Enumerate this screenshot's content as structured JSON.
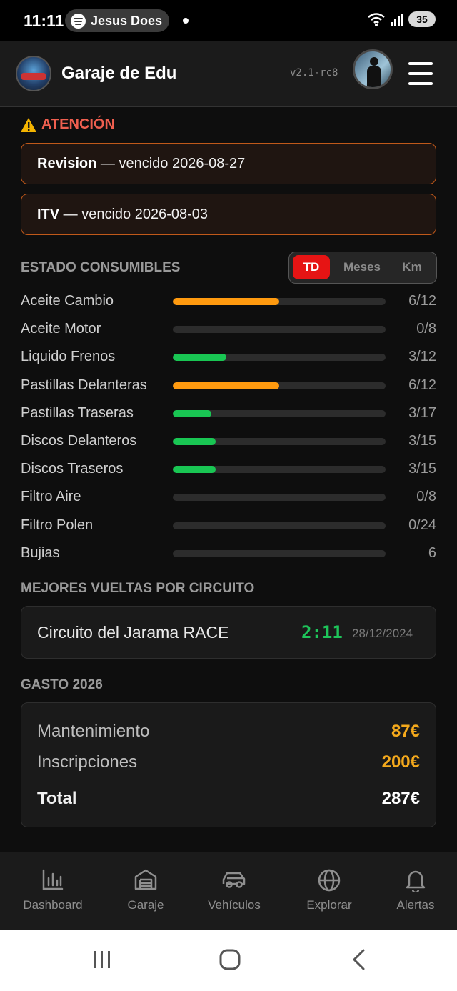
{
  "status_bar": {
    "time": "11:11",
    "media_pill": "Jesus Does",
    "battery": "35"
  },
  "header": {
    "title": "Garaje de Edu",
    "version": "v2.1-rc8"
  },
  "alerts": {
    "title": "ATENCIÓN",
    "items": [
      {
        "name": "Revision",
        "text": " — vencido 2026-08-27"
      },
      {
        "name": "ITV",
        "text": " — vencido 2026-08-03"
      }
    ]
  },
  "consumables": {
    "title": "ESTADO CONSUMIBLES",
    "tabs": [
      "TD",
      "Meses",
      "Km"
    ],
    "active_tab": "TD",
    "colors": {
      "warn": "#ff9a0f",
      "ok": "#19c653"
    },
    "items": [
      {
        "name": "Aceite Cambio",
        "value": "6/12",
        "fraction": 0.5,
        "status": "warn"
      },
      {
        "name": "Aceite Motor",
        "value": "0/8",
        "fraction": 0,
        "status": "ok"
      },
      {
        "name": "Liquido Frenos",
        "value": "3/12",
        "fraction": 0.25,
        "status": "ok"
      },
      {
        "name": "Pastillas Delanteras",
        "value": "6/12",
        "fraction": 0.5,
        "status": "warn"
      },
      {
        "name": "Pastillas Traseras",
        "value": "3/17",
        "fraction": 0.18,
        "status": "ok"
      },
      {
        "name": "Discos Delanteros",
        "value": "3/15",
        "fraction": 0.2,
        "status": "ok"
      },
      {
        "name": "Discos Traseros",
        "value": "3/15",
        "fraction": 0.2,
        "status": "ok"
      },
      {
        "name": "Filtro Aire",
        "value": "0/8",
        "fraction": 0,
        "status": "ok"
      },
      {
        "name": "Filtro Polen",
        "value": "0/24",
        "fraction": 0,
        "status": "ok"
      },
      {
        "name": "Bujias",
        "value": "6",
        "fraction": 0,
        "status": "ok"
      }
    ]
  },
  "laps": {
    "title": "MEJORES VUELTAS POR CIRCUITO",
    "items": [
      {
        "circuit": "Circuito del Jarama RACE",
        "time": "2:11",
        "date": "28/12/2024"
      }
    ]
  },
  "spending": {
    "title": "GASTO 2026",
    "rows": [
      {
        "label": "Mantenimiento",
        "value": "87€"
      },
      {
        "label": "Inscripciones",
        "value": "200€"
      }
    ],
    "total_label": "Total",
    "total_value": "287€"
  },
  "bottom_nav": [
    {
      "label": "Dashboard",
      "icon": "chart-icon"
    },
    {
      "label": "Garaje",
      "icon": "garage-icon"
    },
    {
      "label": "Vehículos",
      "icon": "car-icon"
    },
    {
      "label": "Explorar",
      "icon": "globe-icon"
    },
    {
      "label": "Alertas",
      "icon": "bell-icon"
    }
  ]
}
